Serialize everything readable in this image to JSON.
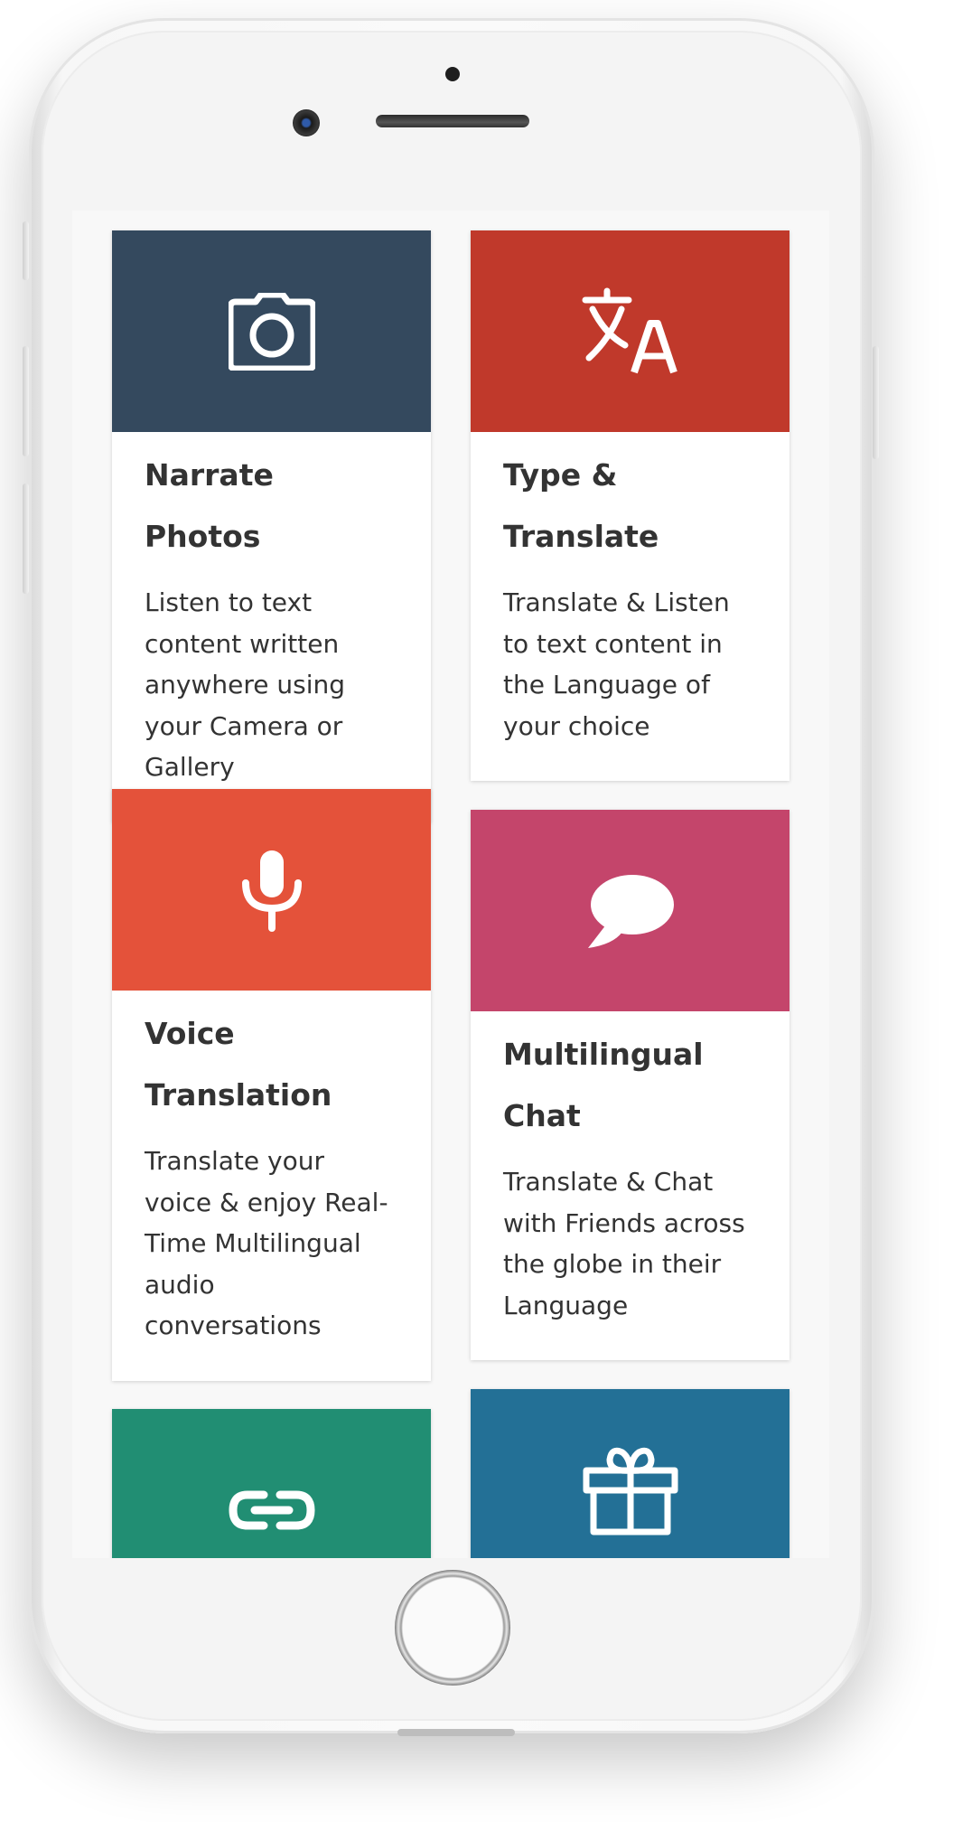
{
  "colors": {
    "narrate_photos": "#34495e",
    "type_translate": "#c0392b",
    "voice_translation": "#e4523a",
    "multilingual_chat": "#c4456b",
    "share_link": "#218e73",
    "gift": "#237096"
  },
  "features": [
    {
      "title": "Narrate Photos",
      "description": "Listen to text content written anywhere using your Camera or Gallery",
      "icon": "camera-icon"
    },
    {
      "title": "Type & Translate",
      "description": "Translate & Listen to text content in the Language of your choice",
      "icon": "translate-icon"
    },
    {
      "title": "Voice Translation",
      "description": "Translate your voice & enjoy Real-Time Multilingual audio conversations",
      "icon": "microphone-icon"
    },
    {
      "title": "Multilingual Chat",
      "description": "Translate & Chat with Friends across the globe in their Language",
      "icon": "chat-bubble-icon"
    },
    {
      "icon": "link-icon"
    },
    {
      "icon": "gift-icon"
    }
  ]
}
